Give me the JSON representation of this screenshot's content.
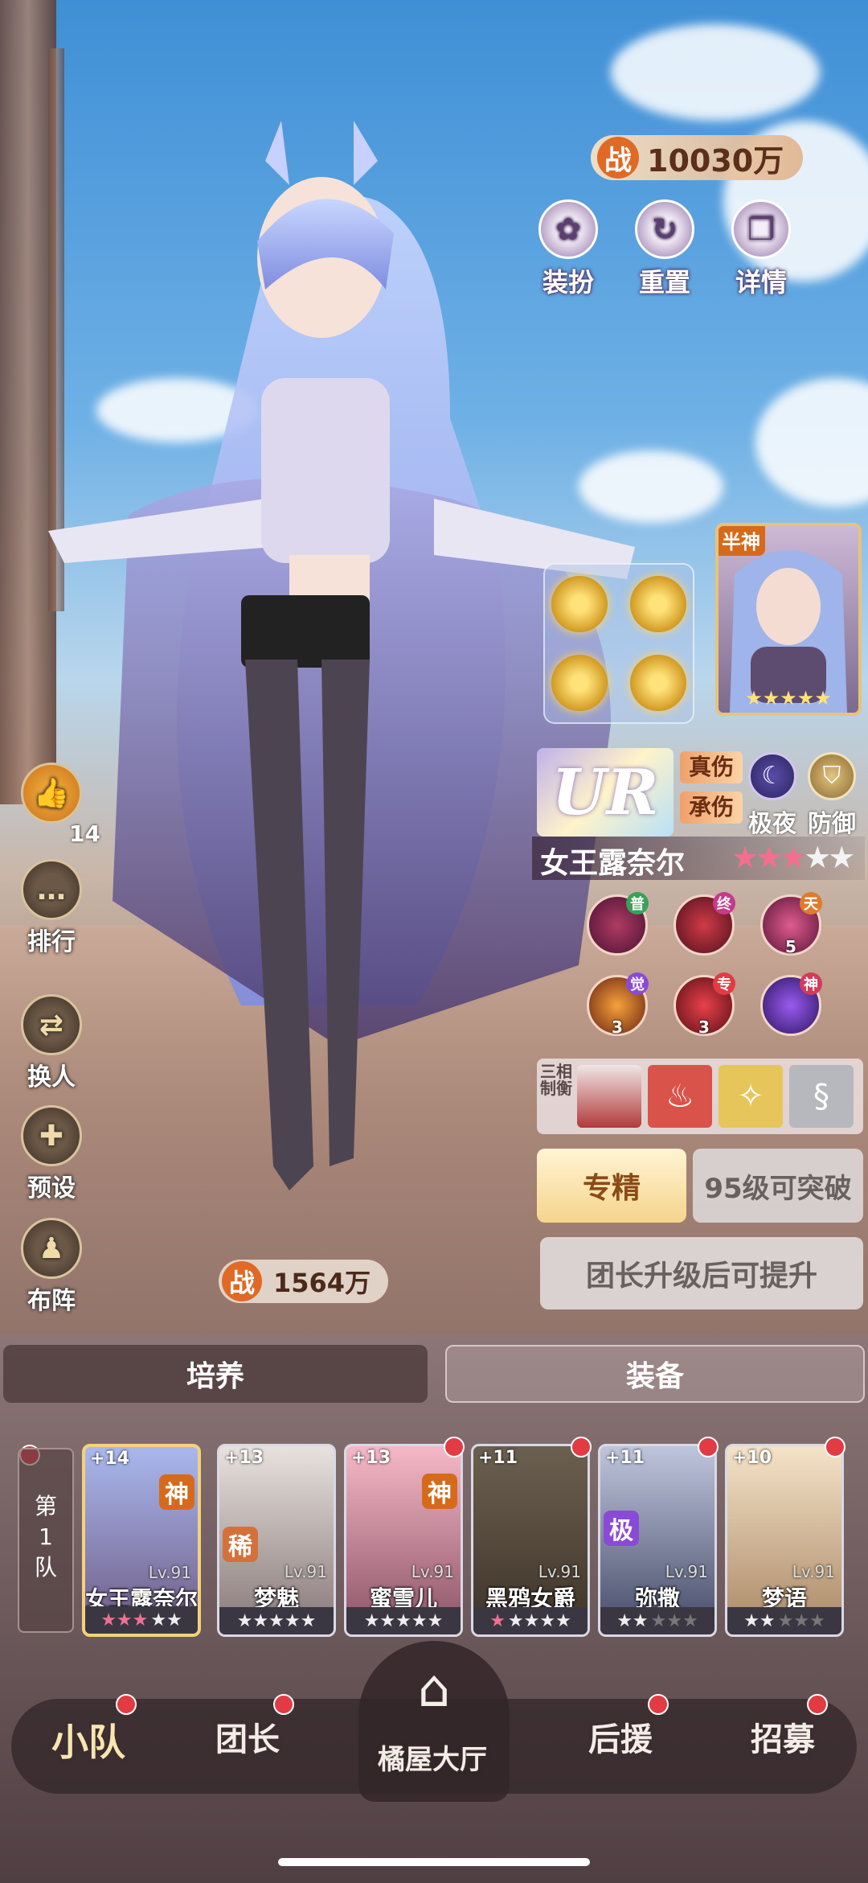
{
  "power_total": {
    "prefix": "战",
    "value": "10030万"
  },
  "top_actions": [
    {
      "label": "装扮",
      "icon": "outfit-icon"
    },
    {
      "label": "重置",
      "icon": "reset-icon"
    },
    {
      "label": "详情",
      "icon": "book-icon"
    }
  ],
  "hero": {
    "rarity": "UR",
    "tags": [
      "真伤",
      "承伤"
    ],
    "attrs": [
      {
        "label": "极夜",
        "icon": "moon-icon"
      },
      {
        "label": "防御",
        "icon": "shield-icon"
      }
    ],
    "name": "女王露奈尔",
    "stars_lit": 3,
    "stars_total": 5,
    "portrait_badge": "半神"
  },
  "skills": [
    {
      "tag": "普",
      "level": ""
    },
    {
      "tag": "终",
      "level": ""
    },
    {
      "tag": "天",
      "level": "5"
    },
    {
      "tag": "觉",
      "level": "3"
    },
    {
      "tag": "专",
      "level": "3"
    },
    {
      "tag": "神",
      "level": ""
    }
  ],
  "triad": {
    "label": "三相制衡"
  },
  "specialization": {
    "active": "专精",
    "locked": "95级可突破"
  },
  "upgrade_hint": "团长升级后可提升",
  "side_menu": [
    {
      "label": "14",
      "icon": "thumbs-up-icon"
    },
    {
      "label": "排行",
      "icon": "chat-icon"
    },
    {
      "label": "换人",
      "icon": "swap-icon"
    },
    {
      "label": "预设",
      "icon": "gamepad-icon"
    },
    {
      "label": "布阵",
      "icon": "formation-icon"
    }
  ],
  "power_hero": {
    "prefix": "战",
    "value": "1564万"
  },
  "main_tabs": [
    "培养",
    "装备"
  ],
  "team_label": "第1队",
  "team": [
    {
      "plus": "+14",
      "name": "女王露奈尔",
      "level": "Lv.91",
      "badge": "神",
      "stars": "★★★★★"
    },
    {
      "plus": "+13",
      "name": "梦魅",
      "level": "Lv.91",
      "badge": "稀",
      "stars": "★★★★★"
    },
    {
      "plus": "+13",
      "name": "蜜雪儿",
      "level": "Lv.91",
      "badge": "神",
      "stars": "★★★★★"
    },
    {
      "plus": "+11",
      "name": "黑鸦女爵",
      "level": "Lv.91",
      "badge": "",
      "stars": "★★★★★"
    },
    {
      "plus": "+11",
      "name": "弥撒",
      "level": "Lv.91",
      "badge": "极",
      "stars": "★★★★★"
    },
    {
      "plus": "+10",
      "name": "梦语",
      "level": "Lv.91",
      "badge": "",
      "stars": "★★★★★"
    }
  ],
  "bottom_nav": [
    "小队",
    "团长",
    "橘屋大厅",
    "后援",
    "招募"
  ]
}
